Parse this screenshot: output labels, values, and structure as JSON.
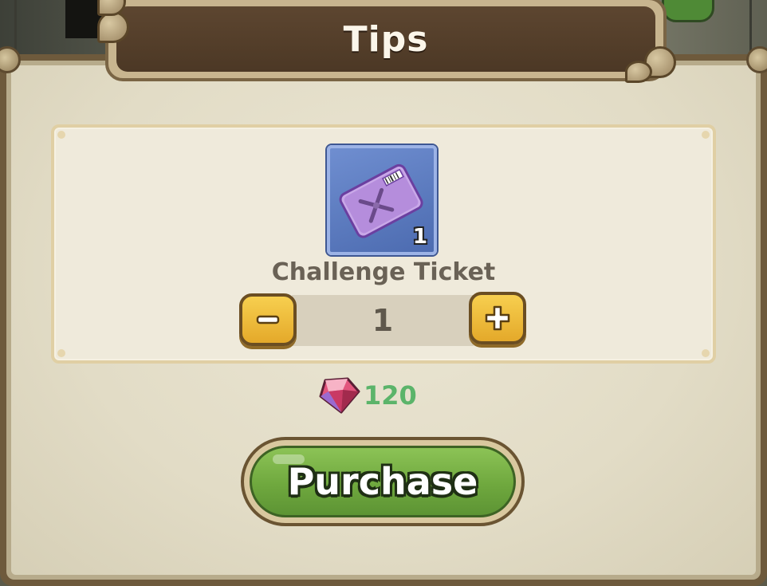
{
  "dialog": {
    "title": "Tips"
  },
  "item": {
    "name": "Challenge Ticket",
    "icon": "challenge-ticket-icon",
    "count": "1"
  },
  "quantity": {
    "value": "1",
    "decrease_icon": "minus-icon",
    "increase_icon": "plus-icon"
  },
  "price": {
    "currency_icon": "gem-icon",
    "amount": "120"
  },
  "actions": {
    "purchase_label": "Purchase"
  },
  "colors": {
    "price_text": "#5bb46a",
    "purchase_button": "#6fa83e",
    "stepper_button": "#e4a92a",
    "title_plaque": "#4c3825"
  }
}
